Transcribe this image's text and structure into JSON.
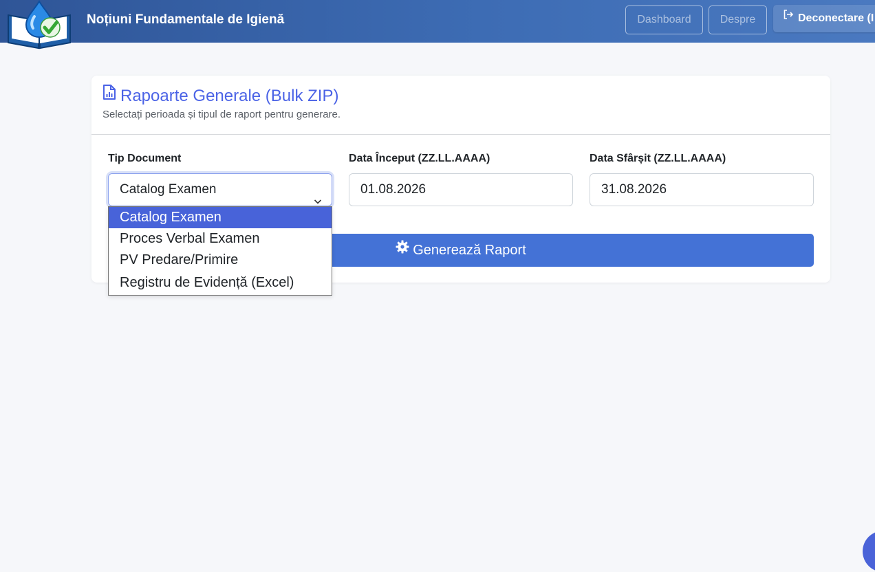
{
  "header": {
    "title": "Noțiuni Fundamentale de Igienă",
    "nav": {
      "dashboard": "Dashboard",
      "despre": "Despre",
      "logout": "Deconectare (I"
    }
  },
  "report_card": {
    "title": "Rapoarte Generale (Bulk ZIP)",
    "subtitle": "Selectați perioada și tipul de raport pentru generare.",
    "fields": {
      "doc_type_label": "Tip Document",
      "doc_type_value": "Catalog Examen",
      "start_label": "Data Început (ZZ.LL.AAAA)",
      "start_value": "01.08.2026",
      "end_label": "Data Sfârșit (ZZ.LL.AAAA)",
      "end_value": "31.08.2026"
    },
    "generate_button": "Generează Raport"
  },
  "doc_type_options": [
    "Catalog Examen",
    "Proces Verbal Examen",
    "PV Predare/Primire",
    "Registru de Evidență (Excel)"
  ],
  "colors": {
    "navbar_start": "#2f5597",
    "navbar_end": "#4a79c0",
    "accent": "#4b63e6",
    "button": "#4472d6",
    "selected_option": "#4863d9"
  },
  "icons": {
    "logo": "book-droplet-check-logo",
    "logout": "logout-icon",
    "title": "file-chart-icon",
    "button": "gear-icon",
    "select": "chevron-down-icon"
  }
}
